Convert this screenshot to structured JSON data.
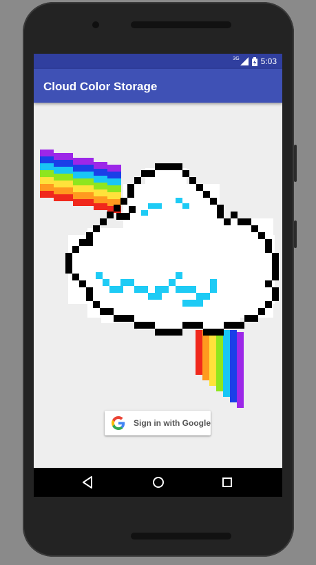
{
  "status_bar": {
    "network": "3G",
    "time": "5:03"
  },
  "app_bar": {
    "title": "Cloud Color Storage"
  },
  "signin": {
    "label": "Sign in with Google",
    "logo_icon": "google-g-icon"
  },
  "nav": {
    "back_icon": "back-triangle-icon",
    "home_icon": "home-circle-icon",
    "recents_icon": "recents-square-icon"
  },
  "colors": {
    "status_bar": "#303f9f",
    "app_bar": "#3f51b5",
    "screen_bg": "#eeeeee"
  }
}
